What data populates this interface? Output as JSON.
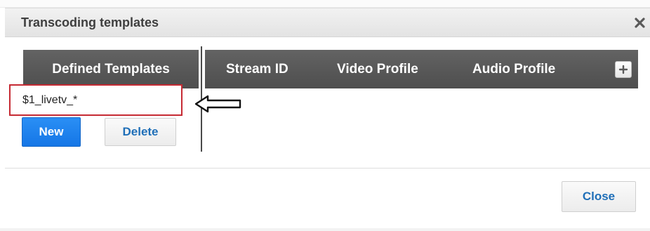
{
  "dialog": {
    "title": "Transcoding templates"
  },
  "templates": {
    "header": "Defined Templates",
    "items": [
      "$1_livetv_*"
    ],
    "new_label": "New",
    "delete_label": "Delete"
  },
  "streams_table": {
    "columns": [
      "Stream ID",
      "Video Profile",
      "Audio Profile"
    ],
    "rows": []
  },
  "footer": {
    "close_label": "Close"
  },
  "icons": {
    "close": "close-x-icon",
    "add": "plus-icon",
    "annotation": "left-arrow-icon"
  },
  "colors": {
    "header_bg": "#555555",
    "primary_button": "#1a7fef",
    "link_text": "#1f6fb8",
    "highlight_border": "#c62a33"
  }
}
